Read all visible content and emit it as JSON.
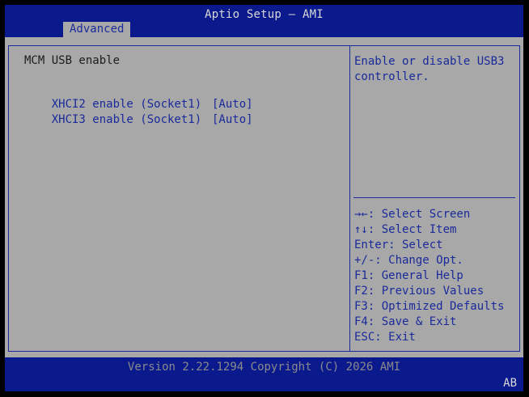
{
  "header": {
    "title": "Aptio Setup – AMI",
    "tab": "Advanced"
  },
  "main": {
    "section_label": "MCM USB enable",
    "items": [
      {
        "label": "XHCI2 enable (Socket1)",
        "value": "[Auto]"
      },
      {
        "label": "XHCI3 enable (Socket1)",
        "value": "[Auto]"
      }
    ]
  },
  "help": {
    "text": "Enable or disable USB3 controller.",
    "keys": [
      "→←: Select Screen",
      "↑↓: Select Item",
      "Enter: Select",
      "+/-: Change Opt.",
      "F1: General Help",
      "F2: Previous Values",
      "F3: Optimized Defaults",
      "F4: Save & Exit",
      "ESC: Exit"
    ]
  },
  "footer": {
    "version": "Version 2.22.1294 Copyright (C) 2026 AMI",
    "badge": "AB"
  },
  "colors": {
    "bar": "#0a1a8c",
    "panel": "#a8a8a8",
    "accent": "#1a2a9a"
  }
}
